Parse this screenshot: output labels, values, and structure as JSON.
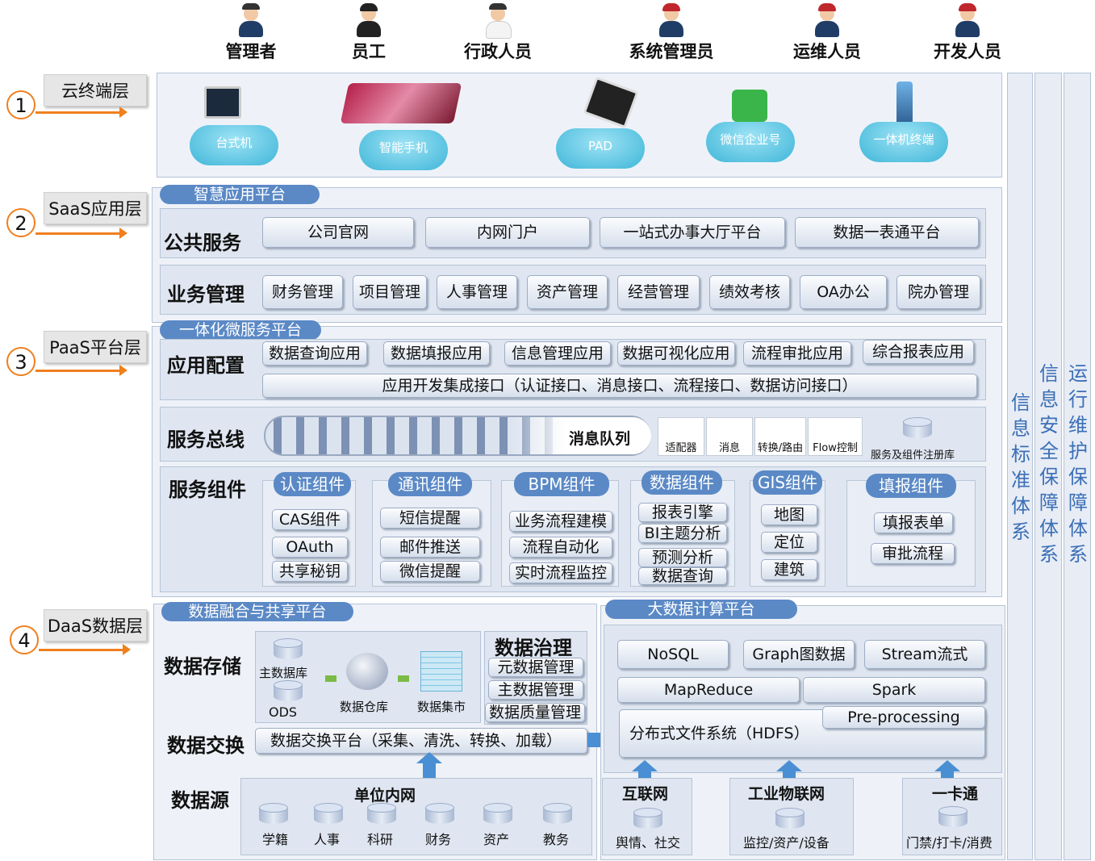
{
  "roles": [
    "管理者",
    "员工",
    "行政人员",
    "系统管理员",
    "运维人员",
    "开发人员"
  ],
  "layers": [
    {
      "num": "1",
      "name": "云终端层"
    },
    {
      "num": "2",
      "name": "SaaS应用层"
    },
    {
      "num": "3",
      "name": "PaaS平台层"
    },
    {
      "num": "4",
      "name": "DaaS数据层"
    }
  ],
  "terminals": [
    "台式机",
    "智能手机",
    "PAD",
    "微信企业号",
    "一体机终端"
  ],
  "saas": {
    "platform": "智慧应用平台",
    "public_title": "公共服务",
    "public": [
      "公司官网",
      "内网门户",
      "一站式办事大厅平台",
      "数据一表通平台"
    ],
    "biz_title": "业务管理",
    "biz": [
      "财务管理",
      "项目管理",
      "人事管理",
      "资产管理",
      "经营管理",
      "绩效考核",
      "OA办公",
      "院办管理"
    ]
  },
  "paas": {
    "platform": "一体化微服务平台",
    "app_title": "应用配置",
    "apps": [
      "数据查询应用",
      "数据填报应用",
      "信息管理应用",
      "数据可视化应用",
      "流程审批应用",
      "综合报表应用"
    ],
    "interface": "应用开发集成接口（认证接口、消息接口、流程接口、数据访问接口）",
    "bus_title": "服务总线",
    "queue": "消息队列",
    "bus_items": [
      "适配器",
      "消息",
      "转换/路由",
      "Flow控制"
    ],
    "registry": "服务及组件注册库",
    "comp_title": "服务组件",
    "components": [
      {
        "name": "认证组件",
        "items": [
          "CAS组件",
          "OAuth",
          "共享秘钥"
        ]
      },
      {
        "name": "通讯组件",
        "items": [
          "短信提醒",
          "邮件推送",
          "微信提醒"
        ]
      },
      {
        "name": "BPM组件",
        "items": [
          "业务流程建模",
          "流程自动化",
          "实时流程监控"
        ]
      },
      {
        "name": "数据组件",
        "items": [
          "报表引擎",
          "BI主题分析",
          "预测分析",
          "数据查询"
        ]
      },
      {
        "name": "GIS组件",
        "items": [
          "地图",
          "定位",
          "建筑"
        ]
      },
      {
        "name": "填报组件",
        "items": [
          "填报表单",
          "审批流程"
        ]
      }
    ]
  },
  "daas": {
    "platform": "数据融合与共享平台",
    "storage_title": "数据存储",
    "master_db": "主数据库",
    "ods": "ODS",
    "warehouse": "数据仓库",
    "mart": "数据集市",
    "gov_title": "数据治理",
    "gov": [
      "元数据管理",
      "主数据管理",
      "数据质量管理"
    ],
    "exchange_title": "数据交换",
    "exchange": "数据交换平台（采集、清洗、转换、加载）",
    "source_title": "数据源",
    "intranet": "单位内网",
    "sources": [
      "学籍",
      "人事",
      "科研",
      "财务",
      "资产",
      "教务"
    ],
    "bigdata": "大数据计算平台",
    "bd_items": [
      "NoSQL",
      "Graph图数据",
      "Stream流式",
      "MapReduce",
      "Spark",
      "Pre-processing"
    ],
    "hdfs": "分布式文件系统（HDFS）",
    "ext": [
      {
        "title": "互联网",
        "label": "舆情、社交"
      },
      {
        "title": "工业物联网",
        "label": "监控/资产/设备"
      },
      {
        "title": "一卡通",
        "label": "门禁/打卡/消费"
      }
    ]
  },
  "columns": [
    "信息标准体系",
    "信息安全保障体系",
    "运行维护保障体系"
  ]
}
